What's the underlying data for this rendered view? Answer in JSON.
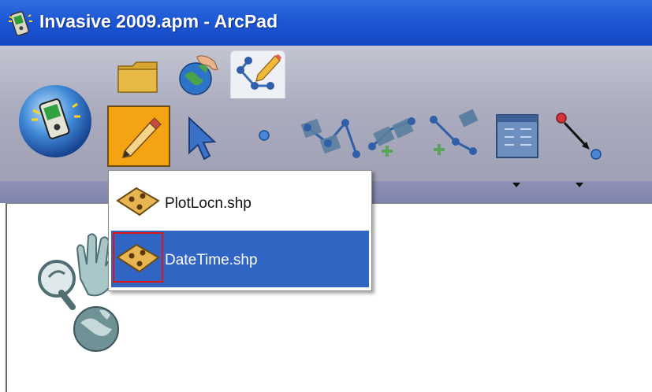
{
  "window": {
    "title": "Invasive 2009.apm - ArcPad"
  },
  "toolbar": {
    "tabs": [
      {
        "name": "folder-icon"
      },
      {
        "name": "globe-hand-icon"
      },
      {
        "name": "edit-tools-icon",
        "selected": true
      }
    ],
    "tools": [
      {
        "name": "pencil-icon",
        "active": true
      },
      {
        "name": "select-arrow-icon"
      },
      {
        "name": "point-icon"
      },
      {
        "name": "add-vertex-icon"
      },
      {
        "name": "insert-vertex-icon"
      },
      {
        "name": "move-vertex-icon"
      },
      {
        "name": "attributes-table-icon"
      },
      {
        "name": "segment-icon"
      }
    ],
    "accent_active": "#f4a312"
  },
  "layer_menu": {
    "items": [
      {
        "label": "PlotLocn.shp",
        "icon": "shapefile-layer-icon"
      },
      {
        "label": "DateTime.shp",
        "icon": "shapefile-layer-icon",
        "highlighted": true
      }
    ],
    "highlight_color": "#3165c4"
  },
  "map_navigation": {
    "icons": [
      "zoom-icon",
      "pan-hand-icon",
      "globe-icon"
    ]
  },
  "colors": {
    "titlebar": "#1d57d4",
    "toolbar": "#a7a8bb",
    "selection_outline": "#e01616"
  }
}
